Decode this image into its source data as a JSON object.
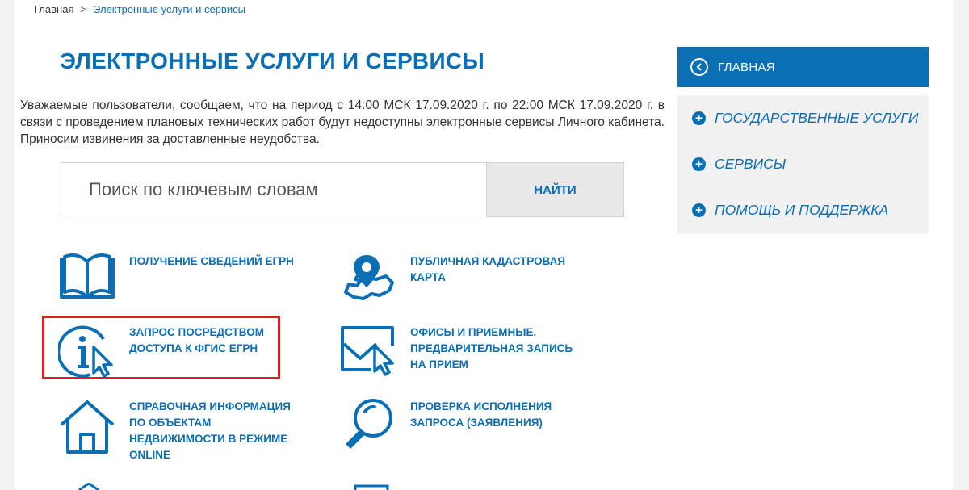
{
  "breadcrumb": {
    "home": "Главная",
    "separator": ">",
    "current": "Электронные услуги и сервисы"
  },
  "page_title": "ЭЛЕКТРОННЫЕ УСЛУГИ И СЕРВИСЫ",
  "notice": "Уважаемые пользователи, сообщаем, что на период с 14:00 МСК 17.09.2020 г. по 22:00 МСК 17.09.2020 г. в связи с проведением плановых технических работ будут недоступны электронные сервисы Личного кабинета. Приносим извинения за доставленные неудобства.",
  "search": {
    "placeholder": "Поиск по ключевым словам",
    "value": "",
    "button_label": "НАЙТИ"
  },
  "services": [
    {
      "label": "ПОЛУЧЕНИЕ СВЕДЕНИЙ ЕГРН",
      "icon": "book-icon"
    },
    {
      "label": "ПУБЛИЧНАЯ КАДАСТРОВАЯ КАРТА",
      "icon": "map-pin-icon"
    },
    {
      "label": "ЗАПРОС ПОСРЕДСТВОМ ДОСТУПА К ФГИС ЕГРН",
      "icon": "info-cursor-icon"
    },
    {
      "label": "ОФИСЫ И ПРИЕМНЫЕ. ПРЕДВАРИТЕЛЬНАЯ ЗАПИСЬ НА ПРИЕМ",
      "icon": "envelope-cursor-icon"
    },
    {
      "label": "СПРАВОЧНАЯ ИНФОРМАЦИЯ ПО ОБЪЕКТАМ НЕДВИЖИМОСТИ В РЕЖИМЕ ONLINE",
      "icon": "house-icon"
    },
    {
      "label": "ПРОВЕРКА ИСПОЛНЕНИЯ ЗАПРОСА (ЗАЯВЛЕНИЯ)",
      "icon": "magnifier-icon"
    }
  ],
  "sidebar": {
    "main_label": "ГЛАВНАЯ",
    "items": [
      {
        "label": "ГОСУДАРСТВЕННЫЕ УСЛУГИ"
      },
      {
        "label": "СЕРВИСЫ"
      },
      {
        "label": "ПОМОЩЬ И ПОДДЕРЖКА"
      }
    ]
  },
  "colors": {
    "accent": "#0b6fb6",
    "highlight": "#e11b22",
    "sidebar_bg": "#f1f1f1",
    "button_bg": "#e8e8e8"
  }
}
